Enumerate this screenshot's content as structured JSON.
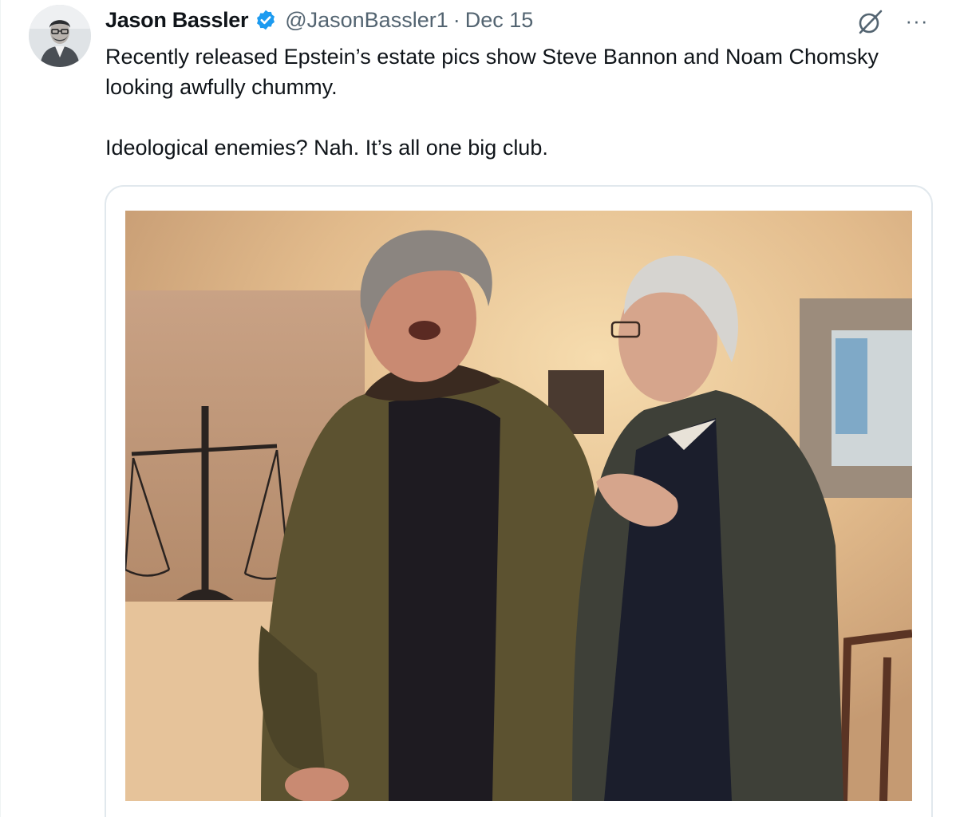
{
  "author": {
    "display_name": "Jason Bassler",
    "handle": "@JasonBassler1",
    "separator": "·",
    "date": "Dec 15",
    "verified": true,
    "verified_color": "#1d9bf0",
    "avatar_icon": "user-avatar"
  },
  "actions": {
    "grok_icon": "grok-icon",
    "more_label": "···"
  },
  "tweet": {
    "paragraphs": [
      "Recently released Epstein’s estate pics show Steve Bannon and Noam Chomsky looking awfully chummy.",
      "Ideological enemies? Nah. It’s all one big club."
    ]
  },
  "media": {
    "type": "photo"
  }
}
